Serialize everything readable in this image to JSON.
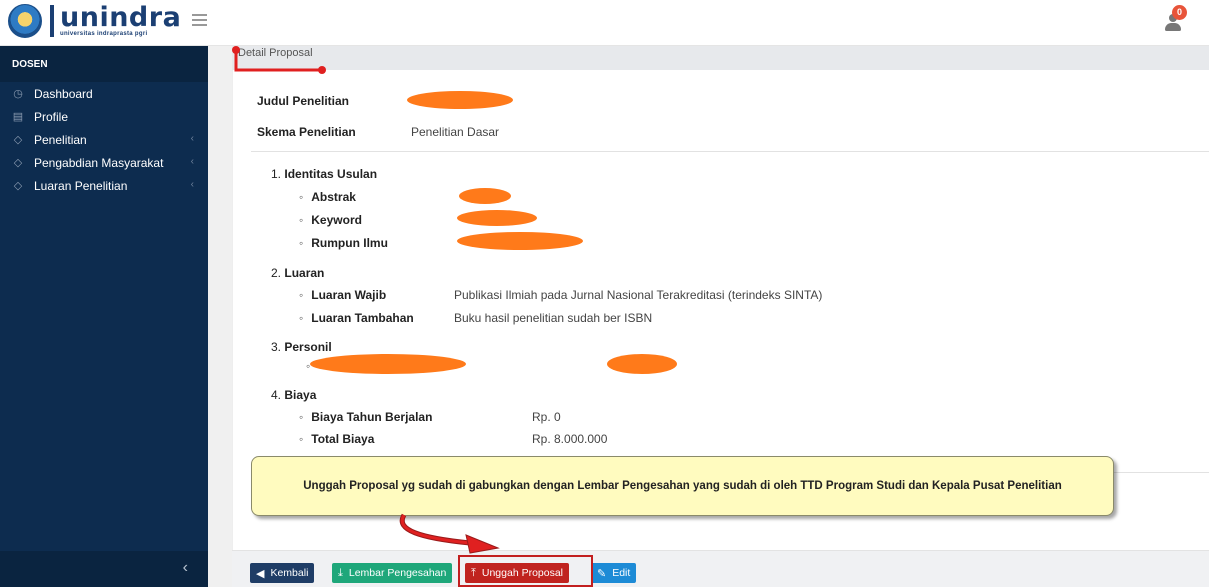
{
  "header": {
    "logo_name": "unindra",
    "logo_sub": "universitas indraprasta pgri",
    "notification_count": "0"
  },
  "sidebar": {
    "heading": "DOSEN",
    "items": [
      {
        "label": "Dashboard",
        "icon": "dashboard-icon",
        "has_submenu": false
      },
      {
        "label": "Profile",
        "icon": "profile-icon",
        "has_submenu": false
      },
      {
        "label": "Penelitian",
        "icon": "tag-icon",
        "has_submenu": true
      },
      {
        "label": "Pengabdian Masyarakat",
        "icon": "tag-icon",
        "has_submenu": true
      },
      {
        "label": "Luaran Penelitian",
        "icon": "tag-icon",
        "has_submenu": true
      }
    ]
  },
  "breadcrumb": "Detail Proposal",
  "proposal": {
    "judul_label": "Judul Penelitian",
    "skema_label": "Skema Penelitian",
    "skema_value": "Penelitian Dasar",
    "sections": {
      "identitas": {
        "number": "1.",
        "title": "Identitas Usulan",
        "abstrak_label": "Abstrak",
        "keyword_label": "Keyword",
        "rumpun_label": "Rumpun Ilmu"
      },
      "luaran": {
        "number": "2.",
        "title": "Luaran",
        "wajib_label": "Luaran Wajib",
        "wajib_value": "Publikasi Ilmiah pada Jurnal Nasional Terakreditasi (terindeks SINTA)",
        "tambahan_label": "Luaran Tambahan",
        "tambahan_value": "Buku hasil penelitian sudah ber ISBN"
      },
      "personil": {
        "number": "3.",
        "title": "Personil"
      },
      "biaya": {
        "number": "4.",
        "title": "Biaya",
        "tahun_label": "Biaya Tahun Berjalan",
        "tahun_value": "Rp. 0",
        "total_label": "Total Biaya",
        "total_value": "Rp. 8.000.000"
      }
    }
  },
  "note": "Unggah Proposal yg sudah di gabungkan dengan Lembar Pengesahan yang sudah di oleh TTD Program Studi dan Kepala Pusat Penelitian",
  "buttons": {
    "back": "Kembali",
    "lembar": "Lembar Pengesahan",
    "unggah": "Unggah Proposal",
    "edit": "Edit"
  },
  "colors": {
    "sidebar_bg": "#0d2c4f",
    "redaction": "#ff7a1a",
    "annotation_red": "#e02020",
    "note_bg": "#fffbbf"
  }
}
